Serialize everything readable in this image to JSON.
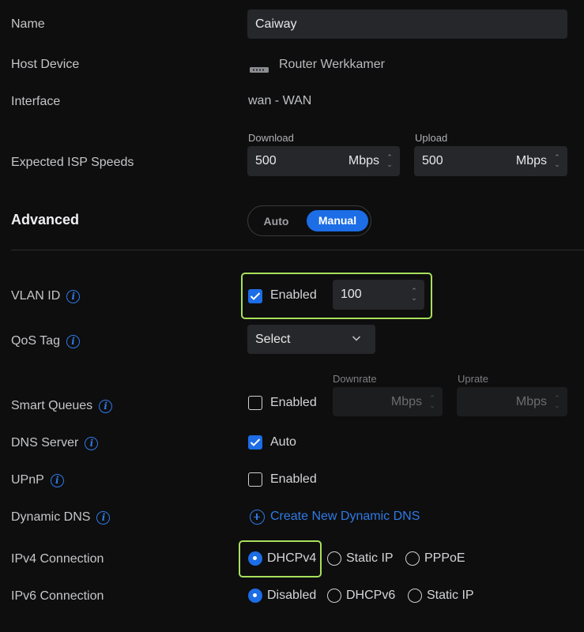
{
  "name": {
    "label": "Name",
    "value": "Caiway"
  },
  "host_device": {
    "label": "Host Device",
    "value": "Router Werkkamer",
    "icon": "router-icon"
  },
  "interface": {
    "label": "Interface",
    "value": "wan - WAN"
  },
  "isp_speeds": {
    "label": "Expected ISP Speeds",
    "download_label": "Download",
    "download_value": "500",
    "download_unit": "Mbps",
    "upload_label": "Upload",
    "upload_value": "500",
    "upload_unit": "Mbps"
  },
  "advanced": {
    "title": "Advanced",
    "toggle_auto": "Auto",
    "toggle_manual": "Manual",
    "selected": "Manual"
  },
  "vlan": {
    "label": "VLAN ID",
    "checkbox_label": "Enabled",
    "checked": true,
    "value": "100"
  },
  "qos": {
    "label": "QoS Tag",
    "select_value": "Select"
  },
  "smart_queues": {
    "label": "Smart Queues",
    "checkbox_label": "Enabled",
    "checked": false,
    "downrate_label": "Downrate",
    "downrate_unit": "Mbps",
    "uprate_label": "Uprate",
    "uprate_unit": "Mbps"
  },
  "dns_server": {
    "label": "DNS Server",
    "checkbox_label": "Auto",
    "checked": true
  },
  "upnp": {
    "label": "UPnP",
    "checkbox_label": "Enabled",
    "checked": false
  },
  "dynamic_dns": {
    "label": "Dynamic DNS",
    "link": "Create New Dynamic DNS"
  },
  "ipv4": {
    "label": "IPv4 Connection",
    "options": [
      "DHCPv4",
      "Static IP",
      "PPPoE"
    ],
    "selected": "DHCPv4"
  },
  "ipv6": {
    "label": "IPv6 Connection",
    "options": [
      "Disabled",
      "DHCPv6",
      "Static IP"
    ],
    "selected": "Disabled"
  },
  "colors": {
    "accent": "#1c6de6",
    "highlight": "#a8e05a",
    "background": "#0e0e0f"
  }
}
